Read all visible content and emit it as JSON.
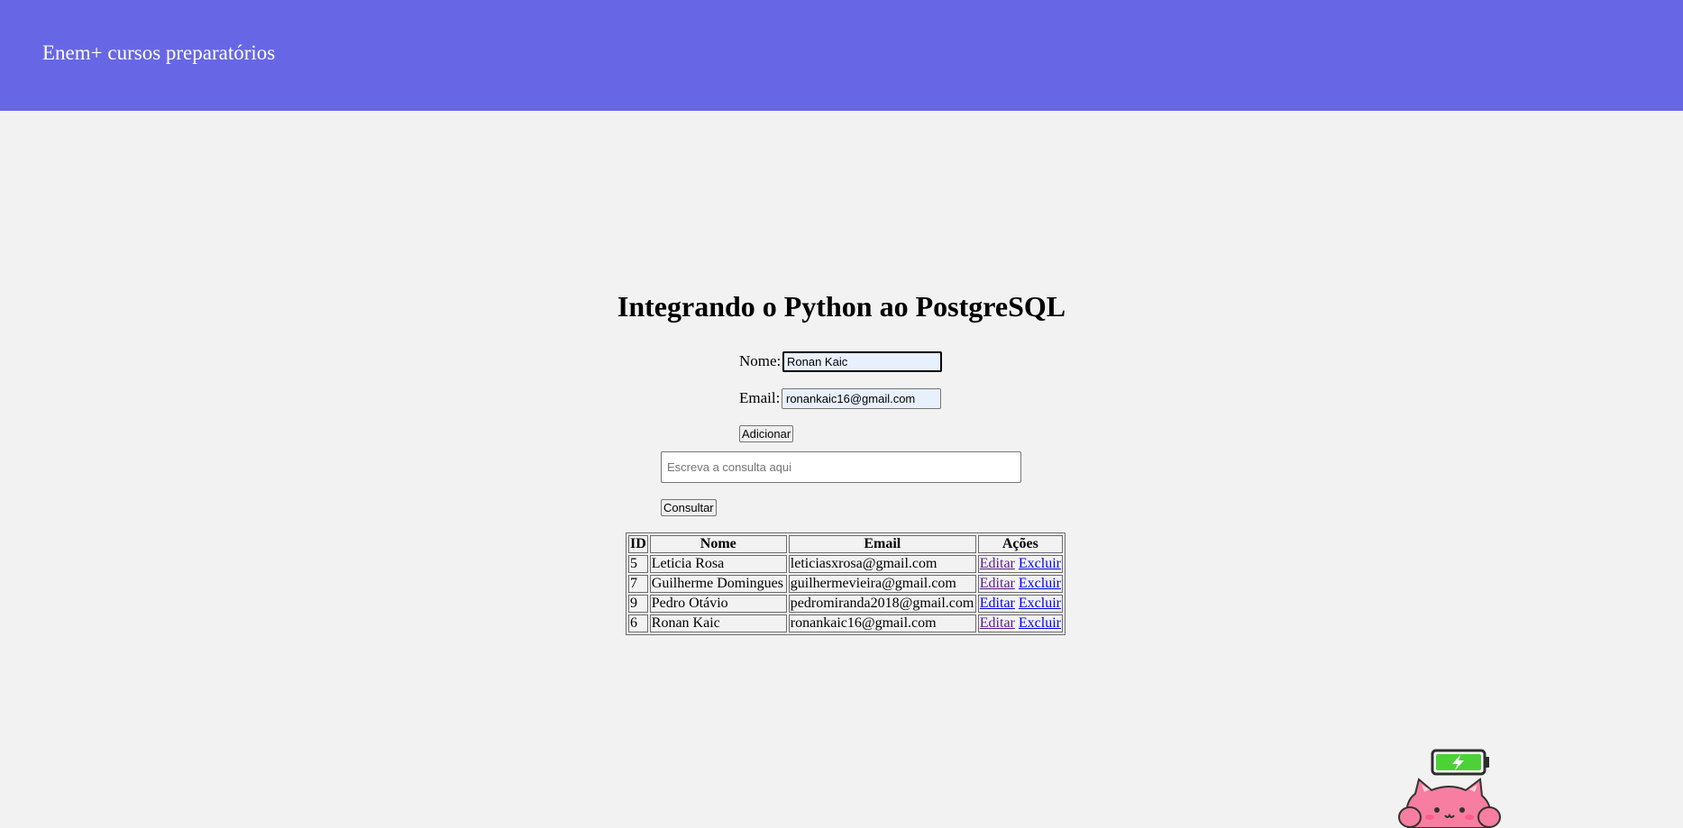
{
  "header": {
    "brand": "Enem+ cursos preparatórios",
    "background_color": "#6767e5"
  },
  "main": {
    "title": "Integrando o Python ao PostgreSQL"
  },
  "form": {
    "nome_label": "Nome:",
    "nome_value": "Ronan Kaic",
    "email_label": "Email:",
    "email_value": "ronankaic16@gmail.com",
    "add_button": "Adicionar"
  },
  "query": {
    "placeholder": "Escreva a consulta aqui",
    "value": "",
    "submit_button": "Consultar"
  },
  "table": {
    "headers": [
      "ID",
      "Nome",
      "Email",
      "Ações"
    ],
    "rows": [
      {
        "id": "5",
        "nome": "Leticia Rosa",
        "email": "leticiasxrosa@gmail.com",
        "edit": "Editar",
        "delete": "Excluir"
      },
      {
        "id": "7",
        "nome": "Guilherme Domingues",
        "email": "guilhermevieira@gmail.com",
        "edit": "Editar",
        "delete": "Excluir"
      },
      {
        "id": "9",
        "nome": "Pedro Otávio",
        "email": "pedromiranda2018@gmail.com",
        "edit": "Editar",
        "delete": "Excluir"
      },
      {
        "id": "6",
        "nome": "Ronan Kaic",
        "email": "ronankaic16@gmail.com",
        "edit": "Editar",
        "delete": "Excluir"
      }
    ]
  },
  "icons": {
    "mascot": "pink-cat-battery-icon"
  },
  "colors": {
    "page_background": "#f2f2f2",
    "link": "#0000ee",
    "visited_link": "#551a8b",
    "battery_green": "#4cd137",
    "cat_pink": "#f77ea0"
  }
}
